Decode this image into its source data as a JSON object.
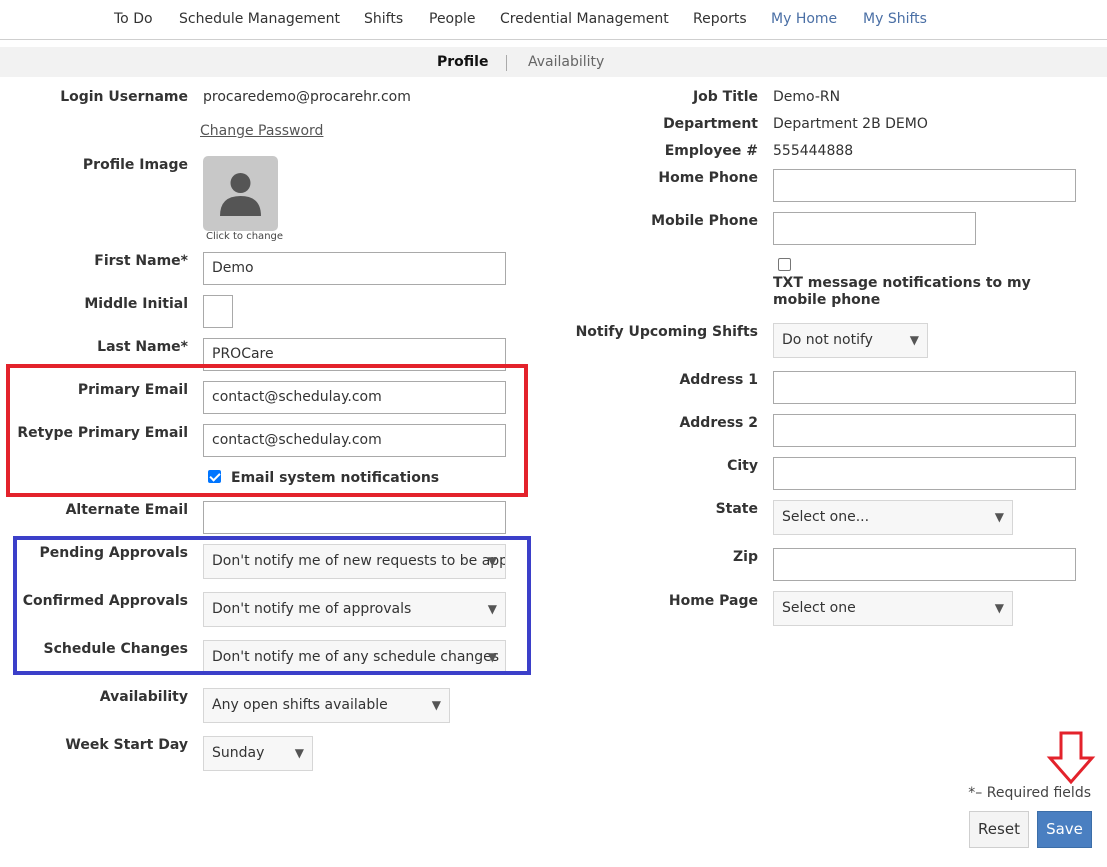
{
  "nav": {
    "items": [
      "To Do",
      "Schedule Management",
      "Shifts",
      "People",
      "Credential Management",
      "Reports",
      "My Home",
      "My Shifts"
    ]
  },
  "subnav": {
    "tabs": [
      "Profile",
      "Availability"
    ]
  },
  "left": {
    "login_username_label": "Login Username",
    "login_username": "procaredemo@procarehr.com",
    "change_password": "Change Password",
    "profile_image_label": "Profile Image",
    "click_to_change": "Click to change",
    "first_name_label": "First Name*",
    "first_name": "Demo",
    "middle_initial_label": "Middle Initial",
    "middle_initial": "",
    "last_name_label": "Last Name*",
    "last_name": "PROCare",
    "primary_email_label": "Primary Email",
    "primary_email": "contact@schedulay.com",
    "retype_email_label": "Retype Primary Email",
    "retype_email": "contact@schedulay.com",
    "email_notifications_label": "Email system notifications",
    "alternate_email_label": "Alternate Email",
    "alternate_email": "",
    "pending_approvals_label": "Pending Approvals",
    "pending_approvals": "Don't notify me of new requests to be approved",
    "confirmed_approvals_label": "Confirmed Approvals",
    "confirmed_approvals": "Don't notify me of approvals",
    "schedule_changes_label": "Schedule Changes",
    "schedule_changes": "Don't notify me of any schedule changes",
    "availability_label": "Availability",
    "availability": "Any open shifts available",
    "week_start_label": "Week Start Day",
    "week_start": "Sunday"
  },
  "right": {
    "job_title_label": "Job Title",
    "job_title": "Demo-RN",
    "department_label": "Department",
    "department": "Department 2B DEMO",
    "employee_label": "Employee #",
    "employee": "555444888",
    "home_phone_label": "Home Phone",
    "home_phone": "",
    "mobile_phone_label": "Mobile Phone",
    "mobile_phone": "",
    "txt_label": "TXT message notifications to my mobile phone",
    "notify_shifts_label": "Notify Upcoming Shifts",
    "notify_shifts": "Do not notify",
    "address1_label": "Address 1",
    "address1": "",
    "address2_label": "Address 2",
    "address2": "",
    "city_label": "City",
    "city": "",
    "state_label": "State",
    "state": "Select one...",
    "zip_label": "Zip",
    "zip": "",
    "home_page_label": "Home Page",
    "home_page": "Select one"
  },
  "footer": {
    "required_note": "*– Required fields",
    "reset": "Reset",
    "save": "Save"
  },
  "colors": {
    "red_highlight": "#e3222b",
    "blue_highlight": "#3b3fc9",
    "save_button": "#4a7fc1",
    "link": "#4a6fa5"
  }
}
